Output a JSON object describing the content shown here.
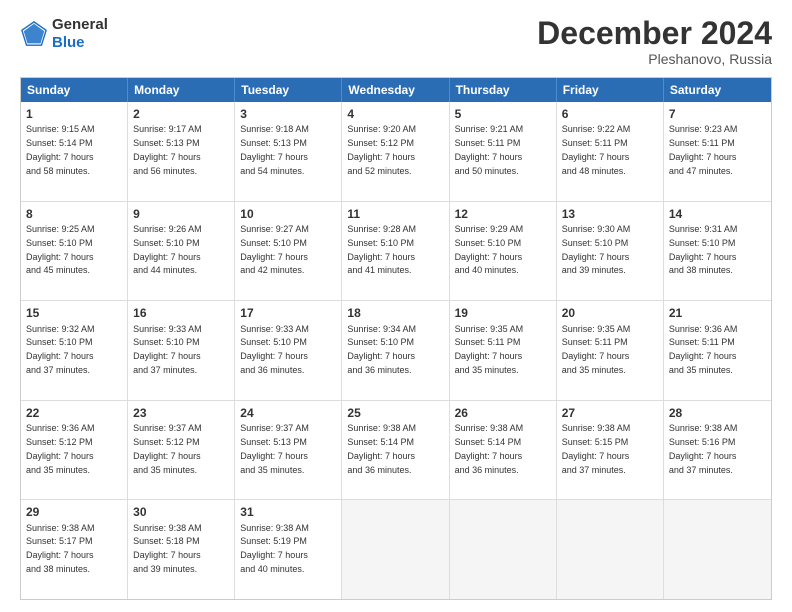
{
  "header": {
    "logo_line1": "General",
    "logo_line2": "Blue",
    "month": "December 2024",
    "location": "Pleshanovo, Russia"
  },
  "weekdays": [
    "Sunday",
    "Monday",
    "Tuesday",
    "Wednesday",
    "Thursday",
    "Friday",
    "Saturday"
  ],
  "rows": [
    [
      {
        "day": "1",
        "rise": "Sunrise: 9:15 AM",
        "set": "Sunset: 5:14 PM",
        "daylight": "Daylight: 7 hours",
        "mins": "and 58 minutes."
      },
      {
        "day": "2",
        "rise": "Sunrise: 9:17 AM",
        "set": "Sunset: 5:13 PM",
        "daylight": "Daylight: 7 hours",
        "mins": "and 56 minutes."
      },
      {
        "day": "3",
        "rise": "Sunrise: 9:18 AM",
        "set": "Sunset: 5:13 PM",
        "daylight": "Daylight: 7 hours",
        "mins": "and 54 minutes."
      },
      {
        "day": "4",
        "rise": "Sunrise: 9:20 AM",
        "set": "Sunset: 5:12 PM",
        "daylight": "Daylight: 7 hours",
        "mins": "and 52 minutes."
      },
      {
        "day": "5",
        "rise": "Sunrise: 9:21 AM",
        "set": "Sunset: 5:11 PM",
        "daylight": "Daylight: 7 hours",
        "mins": "and 50 minutes."
      },
      {
        "day": "6",
        "rise": "Sunrise: 9:22 AM",
        "set": "Sunset: 5:11 PM",
        "daylight": "Daylight: 7 hours",
        "mins": "and 48 minutes."
      },
      {
        "day": "7",
        "rise": "Sunrise: 9:23 AM",
        "set": "Sunset: 5:11 PM",
        "daylight": "Daylight: 7 hours",
        "mins": "and 47 minutes."
      }
    ],
    [
      {
        "day": "8",
        "rise": "Sunrise: 9:25 AM",
        "set": "Sunset: 5:10 PM",
        "daylight": "Daylight: 7 hours",
        "mins": "and 45 minutes."
      },
      {
        "day": "9",
        "rise": "Sunrise: 9:26 AM",
        "set": "Sunset: 5:10 PM",
        "daylight": "Daylight: 7 hours",
        "mins": "and 44 minutes."
      },
      {
        "day": "10",
        "rise": "Sunrise: 9:27 AM",
        "set": "Sunset: 5:10 PM",
        "daylight": "Daylight: 7 hours",
        "mins": "and 42 minutes."
      },
      {
        "day": "11",
        "rise": "Sunrise: 9:28 AM",
        "set": "Sunset: 5:10 PM",
        "daylight": "Daylight: 7 hours",
        "mins": "and 41 minutes."
      },
      {
        "day": "12",
        "rise": "Sunrise: 9:29 AM",
        "set": "Sunset: 5:10 PM",
        "daylight": "Daylight: 7 hours",
        "mins": "and 40 minutes."
      },
      {
        "day": "13",
        "rise": "Sunrise: 9:30 AM",
        "set": "Sunset: 5:10 PM",
        "daylight": "Daylight: 7 hours",
        "mins": "and 39 minutes."
      },
      {
        "day": "14",
        "rise": "Sunrise: 9:31 AM",
        "set": "Sunset: 5:10 PM",
        "daylight": "Daylight: 7 hours",
        "mins": "and 38 minutes."
      }
    ],
    [
      {
        "day": "15",
        "rise": "Sunrise: 9:32 AM",
        "set": "Sunset: 5:10 PM",
        "daylight": "Daylight: 7 hours",
        "mins": "and 37 minutes."
      },
      {
        "day": "16",
        "rise": "Sunrise: 9:33 AM",
        "set": "Sunset: 5:10 PM",
        "daylight": "Daylight: 7 hours",
        "mins": "and 37 minutes."
      },
      {
        "day": "17",
        "rise": "Sunrise: 9:33 AM",
        "set": "Sunset: 5:10 PM",
        "daylight": "Daylight: 7 hours",
        "mins": "and 36 minutes."
      },
      {
        "day": "18",
        "rise": "Sunrise: 9:34 AM",
        "set": "Sunset: 5:10 PM",
        "daylight": "Daylight: 7 hours",
        "mins": "and 36 minutes."
      },
      {
        "day": "19",
        "rise": "Sunrise: 9:35 AM",
        "set": "Sunset: 5:11 PM",
        "daylight": "Daylight: 7 hours",
        "mins": "and 35 minutes."
      },
      {
        "day": "20",
        "rise": "Sunrise: 9:35 AM",
        "set": "Sunset: 5:11 PM",
        "daylight": "Daylight: 7 hours",
        "mins": "and 35 minutes."
      },
      {
        "day": "21",
        "rise": "Sunrise: 9:36 AM",
        "set": "Sunset: 5:11 PM",
        "daylight": "Daylight: 7 hours",
        "mins": "and 35 minutes."
      }
    ],
    [
      {
        "day": "22",
        "rise": "Sunrise: 9:36 AM",
        "set": "Sunset: 5:12 PM",
        "daylight": "Daylight: 7 hours",
        "mins": "and 35 minutes."
      },
      {
        "day": "23",
        "rise": "Sunrise: 9:37 AM",
        "set": "Sunset: 5:12 PM",
        "daylight": "Daylight: 7 hours",
        "mins": "and 35 minutes."
      },
      {
        "day": "24",
        "rise": "Sunrise: 9:37 AM",
        "set": "Sunset: 5:13 PM",
        "daylight": "Daylight: 7 hours",
        "mins": "and 35 minutes."
      },
      {
        "day": "25",
        "rise": "Sunrise: 9:38 AM",
        "set": "Sunset: 5:14 PM",
        "daylight": "Daylight: 7 hours",
        "mins": "and 36 minutes."
      },
      {
        "day": "26",
        "rise": "Sunrise: 9:38 AM",
        "set": "Sunset: 5:14 PM",
        "daylight": "Daylight: 7 hours",
        "mins": "and 36 minutes."
      },
      {
        "day": "27",
        "rise": "Sunrise: 9:38 AM",
        "set": "Sunset: 5:15 PM",
        "daylight": "Daylight: 7 hours",
        "mins": "and 37 minutes."
      },
      {
        "day": "28",
        "rise": "Sunrise: 9:38 AM",
        "set": "Sunset: 5:16 PM",
        "daylight": "Daylight: 7 hours",
        "mins": "and 37 minutes."
      }
    ],
    [
      {
        "day": "29",
        "rise": "Sunrise: 9:38 AM",
        "set": "Sunset: 5:17 PM",
        "daylight": "Daylight: 7 hours",
        "mins": "and 38 minutes."
      },
      {
        "day": "30",
        "rise": "Sunrise: 9:38 AM",
        "set": "Sunset: 5:18 PM",
        "daylight": "Daylight: 7 hours",
        "mins": "and 39 minutes."
      },
      {
        "day": "31",
        "rise": "Sunrise: 9:38 AM",
        "set": "Sunset: 5:19 PM",
        "daylight": "Daylight: 7 hours",
        "mins": "and 40 minutes."
      },
      null,
      null,
      null,
      null
    ]
  ]
}
